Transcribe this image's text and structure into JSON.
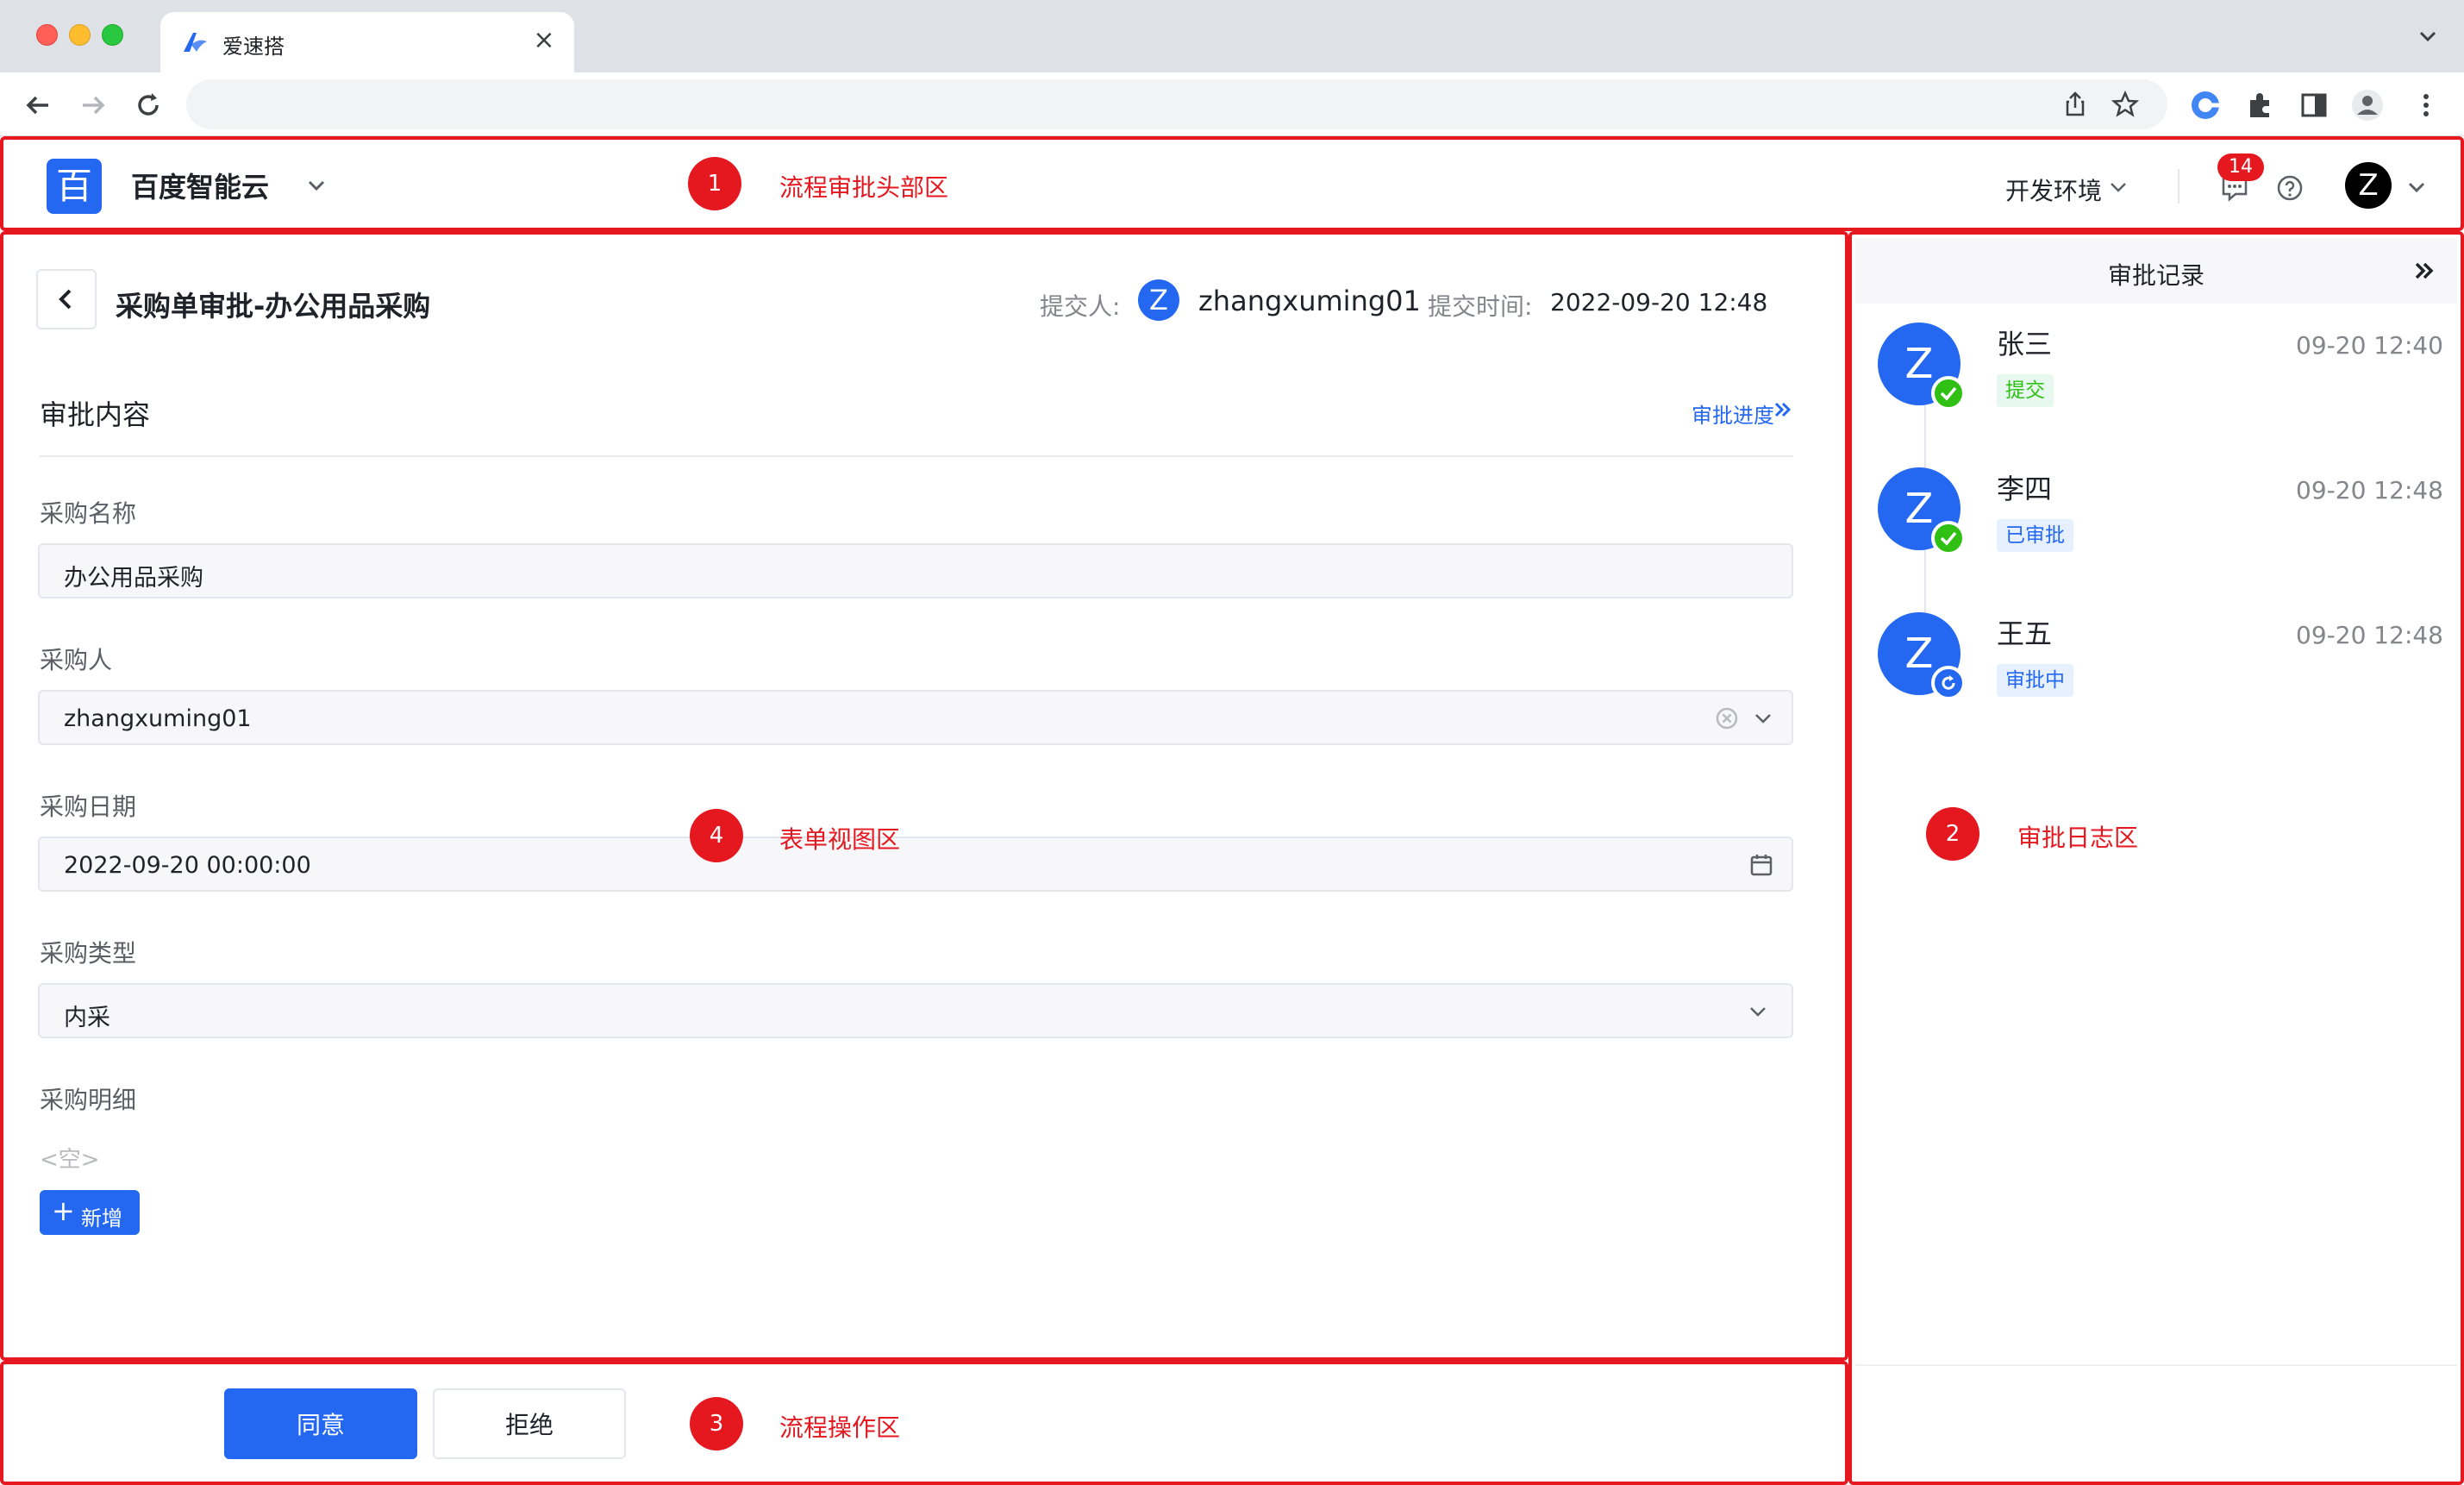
{
  "browser": {
    "tab_title": "爱速搭",
    "tab_close": "×"
  },
  "header": {
    "logo_char": "百",
    "brand": "百度智能云",
    "env_label": "开发环境",
    "message_count": "14",
    "user_initial": "Z"
  },
  "annotations": {
    "m1": {
      "num": "1",
      "label": "流程审批头部区"
    },
    "m2": {
      "num": "2",
      "label": "审批日志区"
    },
    "m3": {
      "num": "3",
      "label": "流程操作区"
    },
    "m4": {
      "num": "4",
      "label": "表单视图区"
    }
  },
  "form": {
    "title": "采购单审批-办公用品采购",
    "submitter_label": "提交人:",
    "submitter_initial": "Z",
    "submitter_name": "zhangxuming01",
    "time_label": "提交时间:",
    "time_value": "2022-09-20 12:48",
    "section_title": "审批内容",
    "progress_link": "审批进度",
    "fields": {
      "name": {
        "label": "采购名称",
        "value": "办公用品采购"
      },
      "buyer": {
        "label": "采购人",
        "value": "zhangxuming01"
      },
      "date": {
        "label": "采购日期",
        "value": "2022-09-20 00:00:00"
      },
      "type": {
        "label": "采购类型",
        "value": "内采"
      },
      "detail": {
        "label": "采购明细",
        "empty": "<空>"
      }
    },
    "add_button": "新增",
    "add_plus": "+"
  },
  "actions": {
    "agree": "同意",
    "reject": "拒绝"
  },
  "log": {
    "title": "审批记录",
    "items": [
      {
        "initial": "Z",
        "name": "张三",
        "time": "09-20 12:40",
        "tag": "提交",
        "status": "done"
      },
      {
        "initial": "Z",
        "name": "李四",
        "time": "09-20 12:48",
        "tag": "已审批",
        "status": "done"
      },
      {
        "initial": "Z",
        "name": "王五",
        "time": "09-20 12:48",
        "tag": "审批中",
        "status": "pending"
      }
    ]
  },
  "colors": {
    "primary": "#2468f2",
    "annotation_red": "#e5171f",
    "success_green": "#30bf13"
  }
}
